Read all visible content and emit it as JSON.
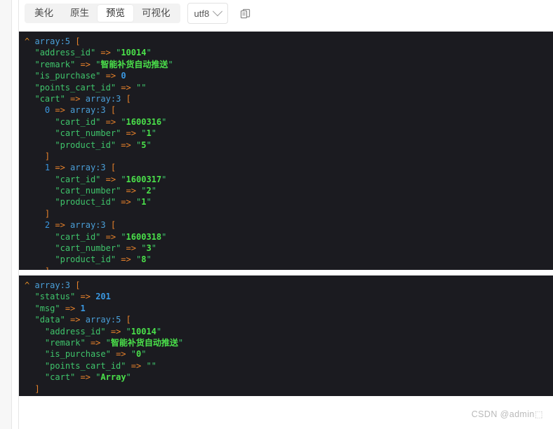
{
  "toolbar": {
    "tabs": [
      {
        "label": "美化",
        "active": false
      },
      {
        "label": "原生",
        "active": false
      },
      {
        "label": "预览",
        "active": true
      },
      {
        "label": "可视化",
        "active": false
      }
    ],
    "encoding": {
      "value": "utf8",
      "icon": "chevron-down-icon"
    },
    "copy": {
      "icon": "copy-icon",
      "title": "复制"
    }
  },
  "watermark": "CSDN @admin⬚",
  "panels": [
    {
      "id": "panel-1",
      "lines": [
        {
          "indent": 0,
          "caret": true,
          "type": "array:5",
          "open": "["
        },
        {
          "indent": 1,
          "key": "address_id",
          "value": "10014",
          "kind": "string"
        },
        {
          "indent": 1,
          "key": "remark",
          "value": "智能补货自动推送",
          "kind": "string"
        },
        {
          "indent": 1,
          "key": "is_purchase",
          "value": "0",
          "kind": "number"
        },
        {
          "indent": 1,
          "key": "points_cart_id",
          "value": "",
          "kind": "string"
        },
        {
          "indent": 1,
          "key": "cart",
          "type": "array:3",
          "open": "["
        },
        {
          "indent": 2,
          "index": "0",
          "type": "array:3",
          "open": "["
        },
        {
          "indent": 3,
          "key": "cart_id",
          "value": "1600316",
          "kind": "string"
        },
        {
          "indent": 3,
          "key": "cart_number",
          "value": "1",
          "kind": "string"
        },
        {
          "indent": 3,
          "key": "product_id",
          "value": "5",
          "kind": "string"
        },
        {
          "indent": 2,
          "close": "]"
        },
        {
          "indent": 2,
          "index": "1",
          "type": "array:3",
          "open": "["
        },
        {
          "indent": 3,
          "key": "cart_id",
          "value": "1600317",
          "kind": "string"
        },
        {
          "indent": 3,
          "key": "cart_number",
          "value": "2",
          "kind": "string"
        },
        {
          "indent": 3,
          "key": "product_id",
          "value": "1",
          "kind": "string"
        },
        {
          "indent": 2,
          "close": "]"
        },
        {
          "indent": 2,
          "index": "2",
          "type": "array:3",
          "open": "["
        },
        {
          "indent": 3,
          "key": "cart_id",
          "value": "1600318",
          "kind": "string"
        },
        {
          "indent": 3,
          "key": "cart_number",
          "value": "3",
          "kind": "string"
        },
        {
          "indent": 3,
          "key": "product_id",
          "value": "8",
          "kind": "string"
        },
        {
          "indent": 2,
          "close": "]"
        },
        {
          "indent": 1,
          "close": "]"
        },
        {
          "indent": 0,
          "close": "]"
        }
      ]
    },
    {
      "id": "panel-2",
      "lines": [
        {
          "indent": 0,
          "caret": true,
          "type": "array:3",
          "open": "["
        },
        {
          "indent": 1,
          "key": "status",
          "value": "201",
          "kind": "number"
        },
        {
          "indent": 1,
          "key": "msg",
          "value": "1",
          "kind": "number"
        },
        {
          "indent": 1,
          "key": "data",
          "type": "array:5",
          "open": "["
        },
        {
          "indent": 2,
          "key": "address_id",
          "value": "10014",
          "kind": "string"
        },
        {
          "indent": 2,
          "key": "remark",
          "value": "智能补货自动推送",
          "kind": "string"
        },
        {
          "indent": 2,
          "key": "is_purchase",
          "value": "0",
          "kind": "string"
        },
        {
          "indent": 2,
          "key": "points_cart_id",
          "value": "",
          "kind": "string"
        },
        {
          "indent": 2,
          "key": "cart",
          "value": "Array",
          "kind": "string"
        },
        {
          "indent": 1,
          "close": "]"
        },
        {
          "indent": 0,
          "close": "]"
        }
      ]
    }
  ]
}
